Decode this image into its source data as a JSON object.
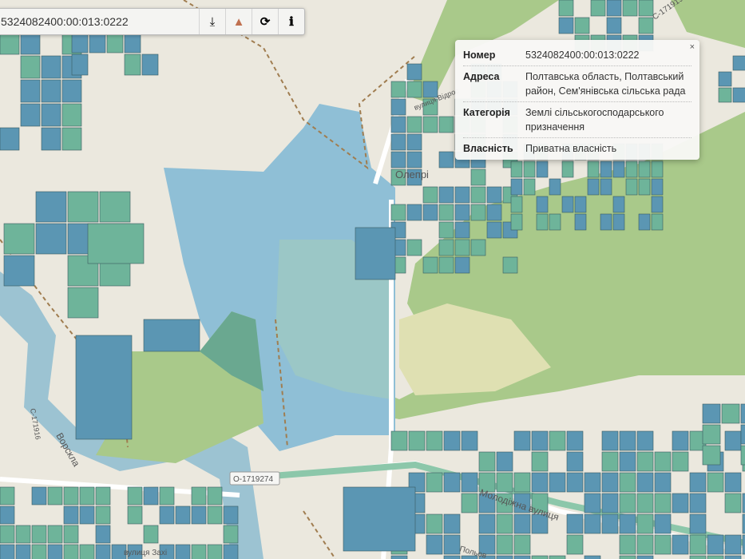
{
  "toolbar": {
    "cadastral_number": "5324082400:00:013:0222",
    "buttons": [
      {
        "icon": "download-icon",
        "glyph": "⤓"
      },
      {
        "icon": "warning-icon",
        "glyph": "▲"
      },
      {
        "icon": "refresh-icon",
        "glyph": "⟳"
      },
      {
        "icon": "info-icon",
        "glyph": "ℹ"
      }
    ]
  },
  "popup": {
    "close": "×",
    "rows": [
      {
        "key": "Номер",
        "value": "5324082400:00:013:0222"
      },
      {
        "key": "Адреса",
        "value": "Полтавська область, Полтавський район, Сем'янівська сільська рада"
      },
      {
        "key": "Категорія",
        "value": "Землі сільськогосподарського призначення"
      },
      {
        "key": "Власність",
        "value": "Приватна власність"
      }
    ]
  },
  "map": {
    "labels": {
      "village": "Олепрі",
      "street_vidr": "вулиця Відрос",
      "road_top": "С-171919",
      "road_left": "С-171916",
      "river": "Ворскла",
      "road_badge": "О-1719274",
      "street_molod": "Молодіжна вулиця",
      "street_zakh": "вулиця Захі",
      "street_polov": "Польов"
    },
    "colors": {
      "parcel_blue": "#5b96b3",
      "parcel_teal": "#6eb49a",
      "forest": "#a9c98a",
      "water": "#9cc3d2"
    }
  }
}
